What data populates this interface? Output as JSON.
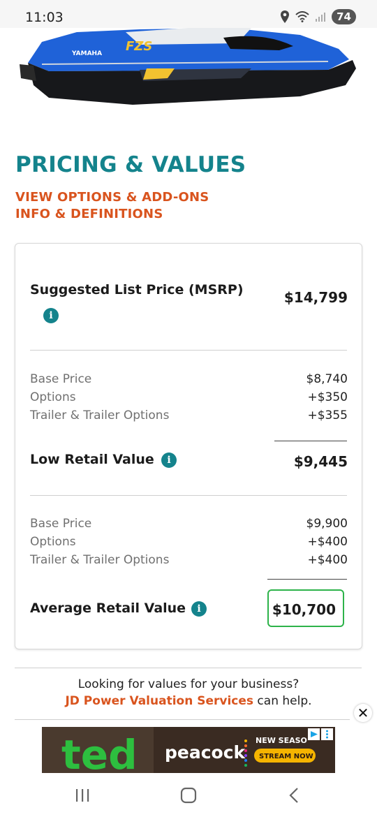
{
  "status_bar": {
    "time": "11:03",
    "battery": "74",
    "icons": [
      "location-icon",
      "wifi-icon",
      "signal-icon",
      "battery-icon"
    ]
  },
  "hero": {
    "brand_text": "YAMAHA",
    "model_text": "FZS"
  },
  "section": {
    "title": "PRICING & VALUES",
    "links": [
      "VIEW OPTIONS & ADD-ONS",
      "INFO & DEFINITIONS"
    ]
  },
  "pricing": {
    "msrp": {
      "label": "Suggested List Price (MSRP)",
      "value": "$14,799"
    },
    "low": {
      "rows": [
        {
          "label": "Base Price",
          "value": "$8,740"
        },
        {
          "label": "Options",
          "value": "+$350"
        },
        {
          "label": "Trailer & Trailer Options",
          "value": "+$355"
        }
      ],
      "total_label": "Low Retail Value",
      "total_value": "$9,445"
    },
    "average": {
      "rows": [
        {
          "label": "Base Price",
          "value": "$9,900"
        },
        {
          "label": "Options",
          "value": "+$400"
        },
        {
          "label": "Trailer & Trailer Options",
          "value": "+$400"
        }
      ],
      "total_label": "Average Retail Value",
      "total_value": "$10,700"
    }
  },
  "business": {
    "line1": "Looking for values for your business?",
    "link": "JD Power Valuation Services",
    "suffix": " can help."
  },
  "ad": {
    "brand": "ted",
    "network": "peacock",
    "tagline": "NEW SEASO",
    "cta": "STREAM NOW",
    "close": "✕"
  },
  "colors": {
    "teal": "#14838c",
    "orange": "#d9541e",
    "green_highlight": "#2db34a",
    "jetski_blue": "#1f62d8"
  }
}
